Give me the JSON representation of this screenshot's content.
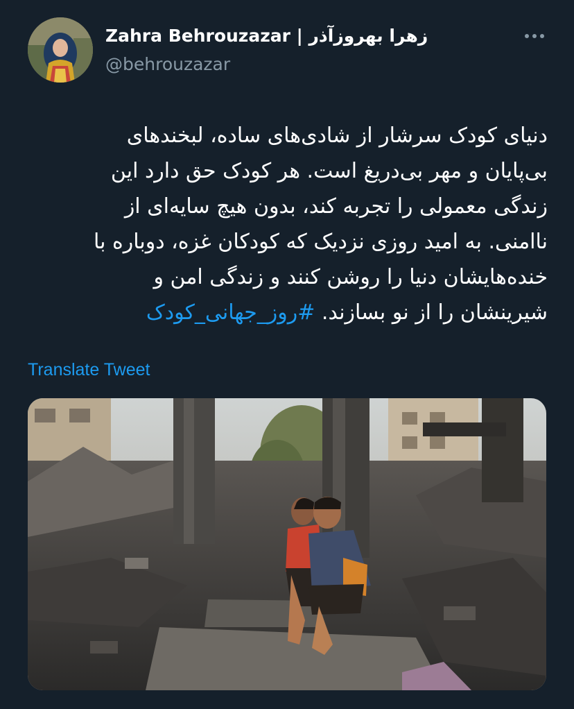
{
  "author": {
    "display_name": "Zahra Behrouzazar | زهرا بهروزآذر",
    "handle": "@behrouzazar",
    "avatar_icon": "profile-photo"
  },
  "tweet": {
    "lines": [
      "دنیای کودک سرشار از شادی‌های ساده، لبخندهای",
      "بی‌پایان و مهر بی‌دریغ است. هر کودک حق دارد این",
      "زندگی معمولی را تجربه کند، بدون هیچ سایه‌ای از",
      "ناامنی. به امید روزی نزدیک که کودکان غزه، دوباره با",
      "خنده‌هایشان دنیا را روشن کنند و زندگی امن و",
      "شیرینشان را از نو بسازند."
    ],
    "hashtag": "#روز_جهانی_کودک"
  },
  "translate_label": "Translate Tweet",
  "more_icon": "more-horizontal-icon",
  "media": {
    "description_icon": "photo"
  },
  "colors": {
    "background": "#15202b",
    "text": "#ffffff",
    "secondary": "#8899a6",
    "accent": "#1d9bf0"
  }
}
